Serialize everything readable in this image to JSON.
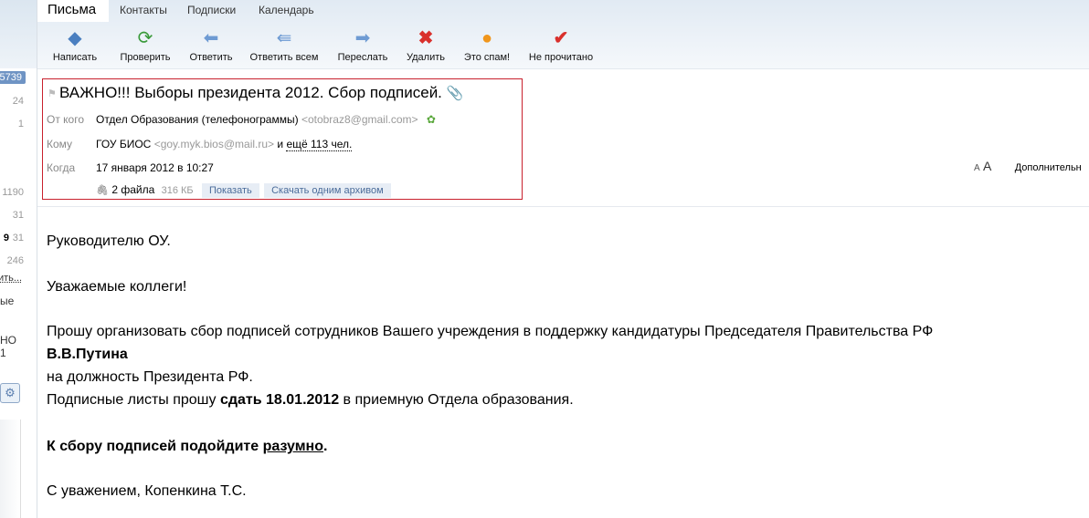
{
  "tabs": [
    "Письма",
    "Контакты",
    "Подписки",
    "Календарь"
  ],
  "toolbar": [
    {
      "label": "Написать",
      "icon": "compose-icon"
    },
    {
      "label": "Проверить",
      "icon": "refresh-icon"
    },
    {
      "label": "Ответить",
      "icon": "reply-icon"
    },
    {
      "label": "Ответить всем",
      "icon": "reply-all-icon"
    },
    {
      "label": "Переслать",
      "icon": "forward-icon"
    },
    {
      "label": "Удалить",
      "icon": "delete-icon"
    },
    {
      "label": "Это спам!",
      "icon": "spam-icon"
    },
    {
      "label": "Не прочитано",
      "icon": "unread-icon"
    }
  ],
  "left_counts": [
    "5739",
    "24",
    "1",
    "1190",
    "31",
    "9",
    "31",
    "246",
    "ить...",
    "ые",
    "НО 1"
  ],
  "message": {
    "subject": "ВАЖНО!!! Выборы президента 2012. Сбор подписей.",
    "from_label": "От кого",
    "from_name": "Отдел Образования (телефонограммы)",
    "from_email": "<otobraz8@gmail.com>",
    "to_label": "Кому",
    "to_name": "ГОУ БИОС",
    "to_email": "<goy.myk.bios@mail.ru>",
    "to_more_prefix": "и",
    "to_more": "ещё 113 чел.",
    "date_label": "Когда",
    "date": "17 января 2012 в 10:27",
    "files": "2 файла",
    "files_size": "316 КБ",
    "show_btn": "Показать",
    "download_btn": "Скачать одним архивом",
    "font_small": "А",
    "font_large": "А",
    "more": "Дополнительн"
  },
  "body": {
    "l1": "Руководителю ОУ.",
    "l2": "Уважаемые коллеги!",
    "l3": "Прошу организовать сбор подписей сотрудников Вашего учреждения в поддержку кандидатуры Председателя Правительства РФ",
    "l4": "В.В.Путина",
    "l5": "на должность Президента РФ.",
    "l6a": "Подписные листы прошу ",
    "l6b": "сдать 18.01.2012",
    "l6c": " в приемную Отдела образования.",
    "l7a": "К сбору подписей подойдите ",
    "l7b": "разумно",
    "l7c": ".",
    "l8": "С уважением, Копенкина Т.С."
  }
}
